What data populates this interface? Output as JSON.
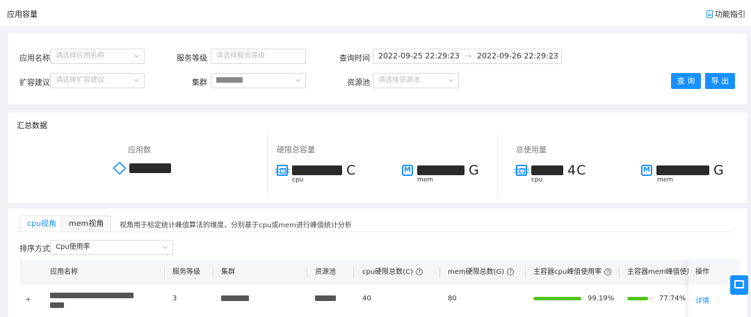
{
  "header": {
    "title": "应用容量",
    "guide_label": "功能指引"
  },
  "filters": {
    "app_name": {
      "label": "应用名称",
      "placeholder": "请选择应用名称"
    },
    "service_level": {
      "label": "服务等级",
      "placeholder": "请选择服务等级"
    },
    "query_time": {
      "label": "查询时间",
      "start": "2022-09-25 22:29:23",
      "arrow": "→",
      "end": "2022-09-26 22:29:23"
    },
    "expand_advice": {
      "label": "扩容建议",
      "placeholder": "请选择扩容建议"
    },
    "cluster": {
      "label": "集群"
    },
    "resource_pool": {
      "label": "资源池",
      "placeholder": "请选择资源池"
    },
    "query_button": "查 询",
    "export_button": "导 出"
  },
  "summary": {
    "title": "汇总数据",
    "app_count_label": "应用数",
    "hard_limit_label": "硬限总容量",
    "total_usage_label": "总使用量",
    "cpu_unit": "C",
    "mem_unit": "G",
    "cpu_sub": "cpu",
    "mem_sub": "mem",
    "usage_cpu_visible": "4C",
    "usage_mem_visible": "G",
    "hard_mem_visible": "G"
  },
  "tabs": {
    "cpu": "cpu视角",
    "mem": "mem视角",
    "hint": "视角用于标定统计峰值算法的维度，分别基于cpu或mem进行峰值统计分析"
  },
  "sort": {
    "label": "排序方式",
    "value": "Cpu使用率"
  },
  "table": {
    "headers": [
      "应用名称",
      "服务等级",
      "集群",
      "资源池",
      "cpu硬限总数(C)",
      "mem硬限总数(G)",
      "主容器cpu峰值使用率",
      "主容器mem峰值使用率",
      "操作"
    ],
    "rows": [
      {
        "level": "3",
        "cpu_limit": "40",
        "mem_limit": "80",
        "cpu_peak": "99.19%",
        "cpu_peak_value": 99.19,
        "mem_peak": "77.74%",
        "mem_peak_value": 77.74,
        "action": "详情"
      }
    ]
  },
  "icons": [
    "doc-icon",
    "chevron-down-icon",
    "calendar-icon",
    "cube-icon",
    "chip-icon",
    "mem-icon",
    "question-circle-icon",
    "expand-plus-icon",
    "chat-icon"
  ],
  "colors": {
    "primary": "#1890ff",
    "success": "#52c41a",
    "background": "#f0f2f5"
  }
}
